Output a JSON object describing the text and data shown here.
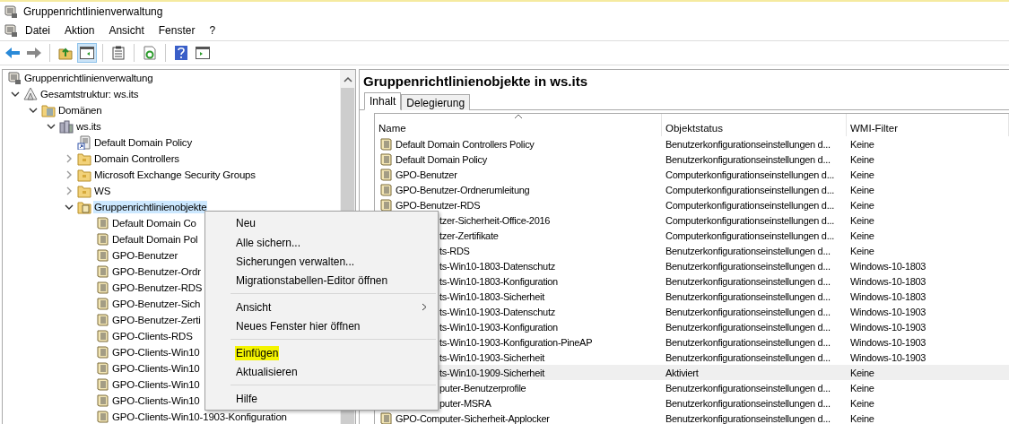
{
  "window": {
    "title": "Gruppenrichtlinienverwaltung"
  },
  "menu_bar": [
    "Datei",
    "Aktion",
    "Ansicht",
    "Fenster",
    "?"
  ],
  "toolbar": [
    {
      "kind": "back",
      "pressed": false
    },
    {
      "kind": "forward",
      "pressed": false
    },
    {
      "kind": "sep"
    },
    {
      "kind": "up",
      "pressed": false
    },
    {
      "kind": "tree",
      "pressed": true
    },
    {
      "kind": "sep"
    },
    {
      "kind": "clipboard",
      "pressed": false
    },
    {
      "kind": "sep"
    },
    {
      "kind": "refresh",
      "pressed": false
    },
    {
      "kind": "sep"
    },
    {
      "kind": "help",
      "pressed": false
    },
    {
      "kind": "pane",
      "pressed": false
    }
  ],
  "tree": [
    {
      "label": "Gruppenrichtlinienverwaltung",
      "kind": "console",
      "selected": false,
      "children": [
        {
          "label": "Gesamtstruktur: ws.its",
          "kind": "forest",
          "expanded": true,
          "selected": false,
          "children": [
            {
              "label": "Domänen",
              "kind": "domains",
              "expanded": true,
              "selected": false,
              "children": [
                {
                  "label": "ws.its",
                  "kind": "domain",
                  "expanded": true,
                  "selected": false,
                  "children": [
                    {
                      "label": "Default Domain Policy",
                      "kind": "link",
                      "selected": false
                    },
                    {
                      "label": "Domain Controllers",
                      "kind": "folder",
                      "expanded": false,
                      "selected": false
                    },
                    {
                      "label": "Microsoft Exchange Security Groups",
                      "kind": "folder",
                      "expanded": false,
                      "selected": false
                    },
                    {
                      "label": "WS",
                      "kind": "folder",
                      "expanded": false,
                      "selected": false
                    },
                    {
                      "label": "Gruppenrichtlinienobjekte",
                      "kind": "gpofolder",
                      "expanded": true,
                      "selected": true,
                      "children": [
                        {
                          "label": "Default Domain Co",
                          "kind": "gpo",
                          "selected": false
                        },
                        {
                          "label": "Default Domain Pol",
                          "kind": "gpo",
                          "selected": false
                        },
                        {
                          "label": "GPO-Benutzer",
                          "kind": "gpo",
                          "selected": false
                        },
                        {
                          "label": "GPO-Benutzer-Ordr",
                          "kind": "gpo",
                          "selected": false
                        },
                        {
                          "label": "GPO-Benutzer-RDS",
                          "kind": "gpo",
                          "selected": false
                        },
                        {
                          "label": "GPO-Benutzer-Sich",
                          "kind": "gpo",
                          "selected": false
                        },
                        {
                          "label": "GPO-Benutzer-Zerti",
                          "kind": "gpo",
                          "selected": false
                        },
                        {
                          "label": "GPO-Clients-RDS",
                          "kind": "gpo",
                          "selected": false
                        },
                        {
                          "label": "GPO-Clients-Win10",
                          "kind": "gpo",
                          "selected": false
                        },
                        {
                          "label": "GPO-Clients-Win10",
                          "kind": "gpo",
                          "selected": false
                        },
                        {
                          "label": "GPO-Clients-Win10",
                          "kind": "gpo",
                          "selected": false
                        },
                        {
                          "label": "GPO-Clients-Win10",
                          "kind": "gpo",
                          "selected": false
                        },
                        {
                          "label": "GPO-Clients-Win10-1903-Konfiguration",
                          "kind": "gpo",
                          "selected": false
                        }
                      ]
                    }
                  ]
                }
              ]
            }
          ]
        }
      ]
    }
  ],
  "details": {
    "title": "Gruppenrichtlinienobjekte in ws.its",
    "tabs": [
      {
        "label": "Inhalt",
        "selected": true
      },
      {
        "label": "Delegierung",
        "selected": false
      }
    ],
    "columns": [
      "Name",
      "Objektstatus",
      "WMI-Filter"
    ],
    "rows": [
      {
        "name": "Default Domain Controllers Policy",
        "status": "Benutzerkonfigurationseinstellungen d...",
        "wmi": "Keine",
        "covered": false,
        "selected": false
      },
      {
        "name": "Default Domain Policy",
        "status": "Benutzerkonfigurationseinstellungen d...",
        "wmi": "Keine",
        "covered": false,
        "selected": false
      },
      {
        "name": "GPO-Benutzer",
        "status": "Computerkonfigurationseinstellungen d...",
        "wmi": "Keine",
        "covered": false,
        "selected": false
      },
      {
        "name": "GPO-Benutzer-Ordnerumleitung",
        "status": "Computerkonfigurationseinstellungen d...",
        "wmi": "Keine",
        "covered": false,
        "selected": false
      },
      {
        "name": "GPO-Benutzer-RDS",
        "status": "Computerkonfigurationseinstellungen d...",
        "wmi": "Keine",
        "covered": false,
        "selected": false
      },
      {
        "name": "tzer-Sicherheit-Office-2016",
        "status": "Computerkonfigurationseinstellungen d...",
        "wmi": "Keine",
        "covered": true,
        "selected": false
      },
      {
        "name": "tzer-Zertifikate",
        "status": "Computerkonfigurationseinstellungen d...",
        "wmi": "Keine",
        "covered": true,
        "selected": false
      },
      {
        "name": "ts-RDS",
        "status": "Benutzerkonfigurationseinstellungen d...",
        "wmi": "Keine",
        "covered": true,
        "selected": false
      },
      {
        "name": "ts-Win10-1803-Datenschutz",
        "status": "Benutzerkonfigurationseinstellungen d...",
        "wmi": "Windows-10-1803",
        "covered": true,
        "selected": false
      },
      {
        "name": "ts-Win10-1803-Konfiguration",
        "status": "Benutzerkonfigurationseinstellungen d...",
        "wmi": "Windows-10-1803",
        "covered": true,
        "selected": false
      },
      {
        "name": "ts-Win10-1803-Sicherheit",
        "status": "Benutzerkonfigurationseinstellungen d...",
        "wmi": "Windows-10-1803",
        "covered": true,
        "selected": false
      },
      {
        "name": "ts-Win10-1903-Datenschutz",
        "status": "Benutzerkonfigurationseinstellungen d...",
        "wmi": "Windows-10-1903",
        "covered": true,
        "selected": false
      },
      {
        "name": "ts-Win10-1903-Konfiguration",
        "status": "Benutzerkonfigurationseinstellungen d...",
        "wmi": "Windows-10-1903",
        "covered": true,
        "selected": false
      },
      {
        "name": "ts-Win10-1903-Konfiguration-PineAP",
        "status": "Benutzerkonfigurationseinstellungen d...",
        "wmi": "Windows-10-1903",
        "covered": true,
        "selected": false
      },
      {
        "name": "ts-Win10-1903-Sicherheit",
        "status": "Benutzerkonfigurationseinstellungen d...",
        "wmi": "Windows-10-1903",
        "covered": true,
        "selected": false
      },
      {
        "name": "ts-Win10-1909-Sicherheit",
        "status": "Aktiviert",
        "wmi": "Keine",
        "covered": true,
        "selected": true
      },
      {
        "name": "puter-Benutzerprofile",
        "status": "Benutzerkonfigurationseinstellungen d...",
        "wmi": "Keine",
        "covered": true,
        "selected": false
      },
      {
        "name": "puter-MSRA",
        "status": "Benutzerkonfigurationseinstellungen d...",
        "wmi": "Keine",
        "covered": true,
        "selected": false
      },
      {
        "name": "GPO-Computer-Sicherheit-Applocker",
        "status": "Benutzerkonfigurationseinstellungen d...",
        "wmi": "Keine",
        "covered": false,
        "selected": false
      }
    ]
  },
  "context_menu": {
    "groups": [
      [
        {
          "label": "Neu",
          "submenu": false,
          "marked": false
        },
        {
          "label": "Alle sichern...",
          "submenu": false,
          "marked": false
        },
        {
          "label": "Sicherungen verwalten...",
          "submenu": false,
          "marked": false
        },
        {
          "label": "Migrationstabellen-Editor öffnen",
          "submenu": false,
          "marked": false
        }
      ],
      [
        {
          "label": "Ansicht",
          "submenu": true,
          "marked": false
        },
        {
          "label": "Neues Fenster hier öffnen",
          "submenu": false,
          "marked": false
        }
      ],
      [
        {
          "label": "Einfügen",
          "submenu": false,
          "marked": true
        },
        {
          "label": "Aktualisieren",
          "submenu": false,
          "marked": false
        }
      ],
      [
        {
          "label": "Hilfe",
          "submenu": false,
          "marked": false
        }
      ]
    ]
  }
}
